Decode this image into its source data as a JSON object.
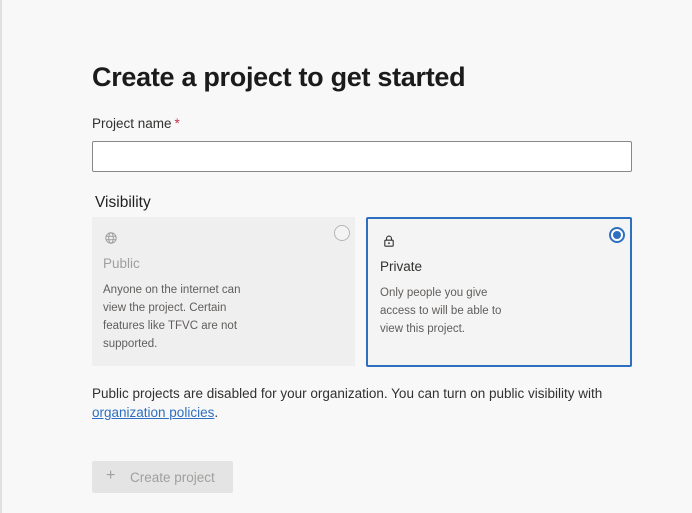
{
  "page": {
    "title": "Create a project to get started"
  },
  "project_name": {
    "label": "Project name",
    "required_marker": "*",
    "value": "",
    "placeholder": ""
  },
  "visibility": {
    "label": "Visibility",
    "selected": "private",
    "options": [
      {
        "id": "public",
        "icon": "globe-icon",
        "title": "Public",
        "description": "Anyone on the internet can view the project. Certain features like TFVC are not supported.",
        "disabled": true,
        "selected": false
      },
      {
        "id": "private",
        "icon": "lock-icon",
        "title": "Private",
        "description": "Only people you give access to will be able to view this project.",
        "disabled": false,
        "selected": true
      }
    ]
  },
  "notice": {
    "text": "Public projects are disabled for your organization. You can turn on public visibility with",
    "link_text": "organization policies",
    "suffix": "."
  },
  "actions": {
    "create_icon": "+",
    "create_label": "Create project",
    "create_disabled": true
  },
  "colors": {
    "accent": "#2f6fbf",
    "link": "#2e6fc2",
    "required": "#c4314b",
    "disabled_text": "#a19f9d"
  }
}
